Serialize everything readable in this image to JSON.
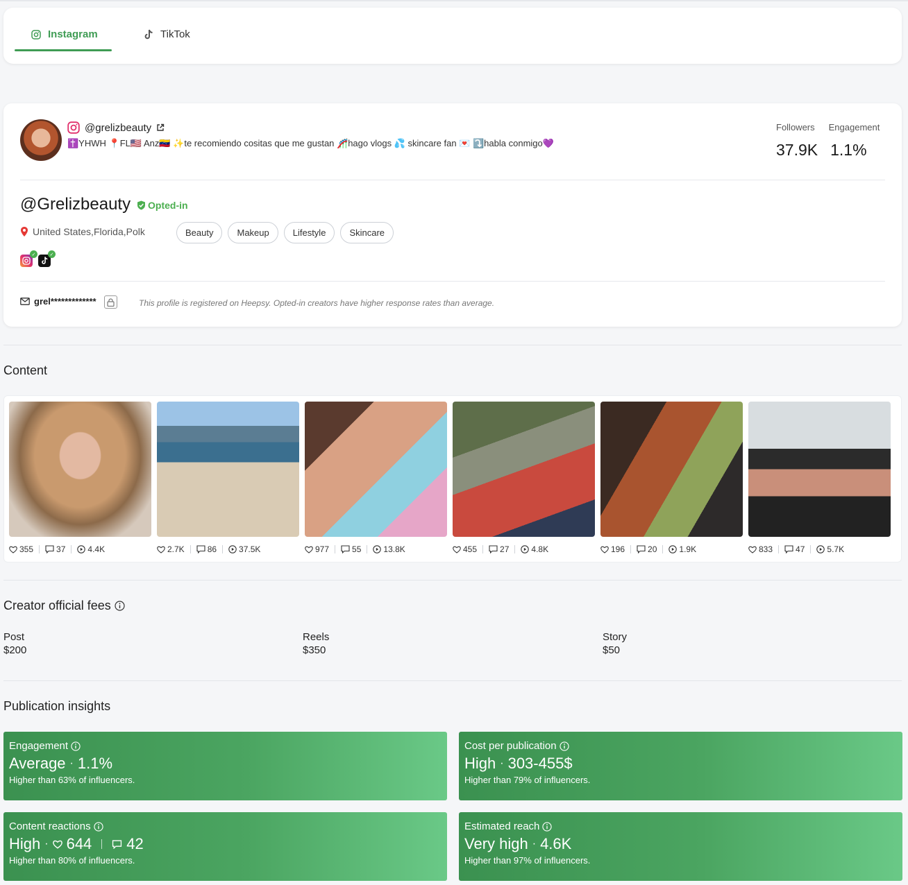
{
  "tabs": [
    {
      "label": "Instagram",
      "icon": "instagram-icon",
      "active": true
    },
    {
      "label": "TikTok",
      "icon": "tiktok-icon",
      "active": false
    }
  ],
  "profile": {
    "handle": "@grelizbeauty",
    "bio": "✝️YHWH 📍FL🇺🇸 Anz🇻🇪 ✨te recomiendo cositas que me gustan 🎢hago vlogs 💦 skincare fan 💌 ⤵️habla conmigo💜",
    "followers_label": "Followers",
    "engagement_label": "Engagement",
    "followers": "37.9K",
    "engagement": "1.1%",
    "name": "@Grelizbeauty",
    "opted_in": "Opted-in",
    "location": "United States,Florida,Polk",
    "tags": [
      "Beauty",
      "Makeup",
      "Lifestyle",
      "Skincare"
    ],
    "email_masked": "grel*************",
    "registration_note": "This profile is registered on Heepsy. Opted-in creators have higher response rates than average."
  },
  "content": {
    "title": "Content",
    "posts": [
      {
        "likes": "355",
        "comments": "37",
        "views": "4.4K"
      },
      {
        "likes": "2.7K",
        "comments": "86",
        "views": "37.5K"
      },
      {
        "likes": "977",
        "comments": "55",
        "views": "13.8K"
      },
      {
        "likes": "455",
        "comments": "27",
        "views": "4.8K"
      },
      {
        "likes": "196",
        "comments": "20",
        "views": "1.9K"
      },
      {
        "likes": "833",
        "comments": "47",
        "views": "5.7K"
      }
    ]
  },
  "fees": {
    "title": "Creator official fees",
    "items": [
      {
        "label": "Post",
        "value": "$200"
      },
      {
        "label": "Reels",
        "value": "$350"
      },
      {
        "label": "Story",
        "value": "$50"
      }
    ]
  },
  "insights": {
    "title": "Publication insights",
    "engagement": {
      "title": "Engagement",
      "level": "Average",
      "value": "1.1%",
      "sub": "Higher than 63% of influencers."
    },
    "cost": {
      "title": "Cost per publication",
      "level": "High",
      "value": "303-455$",
      "sub": "Higher than 79% of influencers."
    },
    "reactions": {
      "title": "Content reactions",
      "level": "High",
      "likes": "644",
      "comments": "42",
      "sub": "Higher than 80% of influencers."
    },
    "reach": {
      "title": "Estimated reach",
      "level": "Very high",
      "value": "4.6K",
      "sub": "Higher than 97% of influencers."
    }
  },
  "colors": {
    "accent": "#3f9c54",
    "optin": "#4caf50",
    "card": "#ffffff",
    "background": "#f5f6f8"
  }
}
